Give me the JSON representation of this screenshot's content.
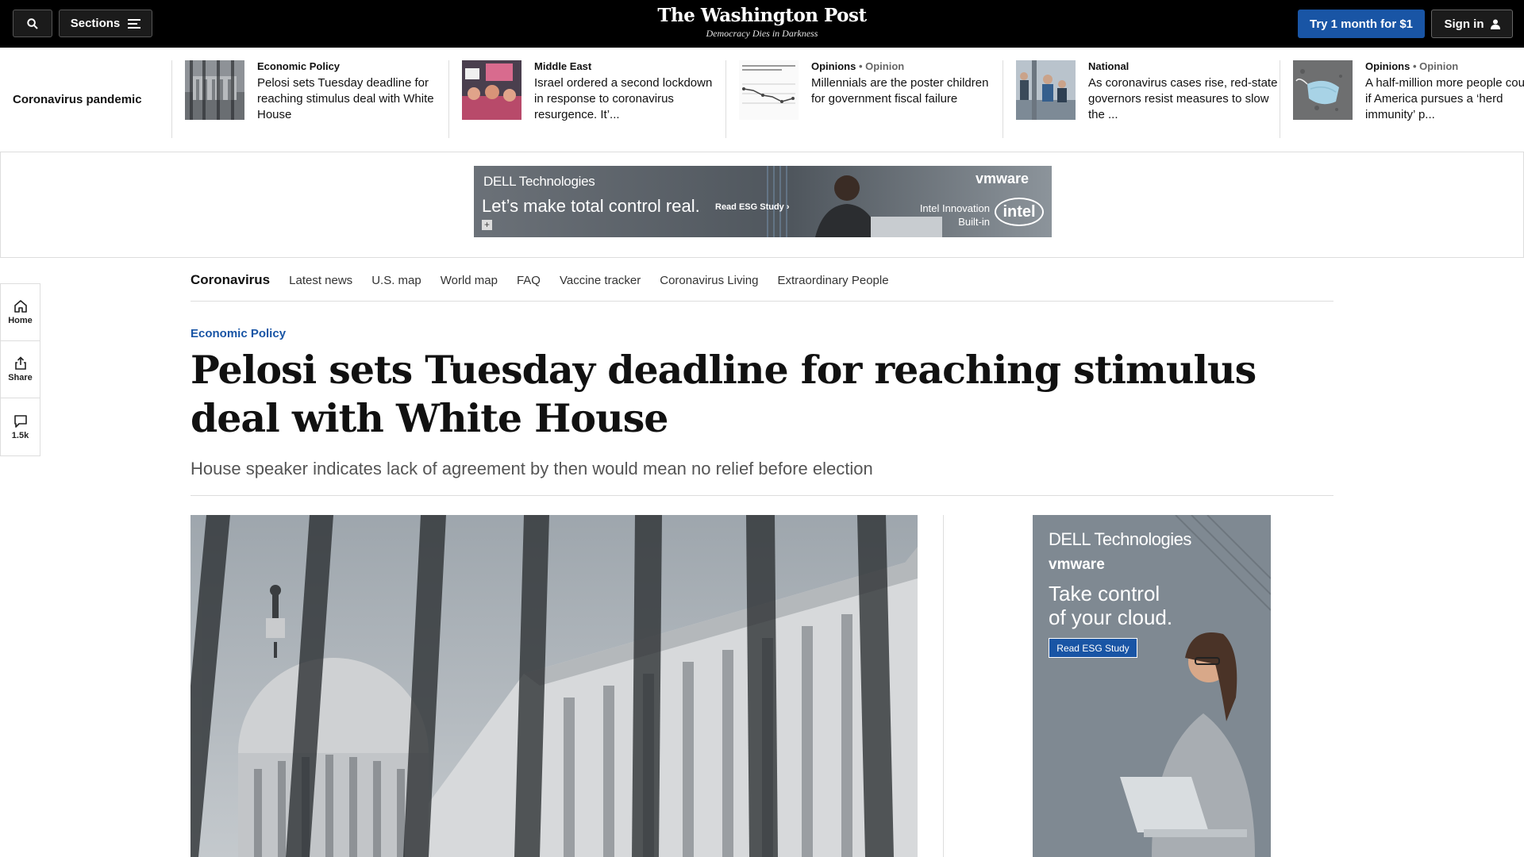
{
  "topbar": {
    "sections_label": "Sections",
    "logo_name": "The Washington Post",
    "logo_tagline": "Democracy Dies in Darkness",
    "try_label": "Try 1 month for $1",
    "signin_label": "Sign in",
    "bg_color": "#000000",
    "accent_color": "#1955a5"
  },
  "strip": {
    "label": "Coronavirus pandemic",
    "items": [
      {
        "kicker": "Economic Policy",
        "opinion": "",
        "headline": "Pelosi sets Tuesday deadline for reaching stimulus deal with White House",
        "thumb_icon": "capitol-building-photo"
      },
      {
        "kicker": "Middle East",
        "opinion": "",
        "headline": "Israel ordered a second lockdown in response to coronavirus resurgence. It’...",
        "thumb_icon": "protest-crowd-photo"
      },
      {
        "kicker": "Opinions",
        "opinion": "• Opinion",
        "headline": "Millennials are the poster children for government fiscal failure",
        "thumb_icon": "line-chart-thumbnail"
      },
      {
        "kicker": "National",
        "opinion": "",
        "headline": "As coronavirus cases rise, red-state governors resist measures to slow the ...",
        "thumb_icon": "people-seated-photo"
      },
      {
        "kicker": "Opinions",
        "opinion": "• Opinion",
        "headline": "A half-million more people could die if America pursues a ‘herd immunity’ p...",
        "thumb_icon": "face-mask-photo"
      }
    ]
  },
  "ad_banner": {
    "brand": "DELL Technologies",
    "line": "Let’s make total control real.",
    "cta": "Read ESG Study ›",
    "partner": "vmware",
    "intel_text": "Intel Innovation Built-in",
    "intel_logo": "intel"
  },
  "section_nav": {
    "title": "Coronavirus",
    "links": [
      "Latest news",
      "U.S. map",
      "World map",
      "FAQ",
      "Vaccine tracker",
      "Coronavirus Living",
      "Extraordinary People"
    ]
  },
  "rail": {
    "home": "Home",
    "share": "Share",
    "comments": "1.5k"
  },
  "article": {
    "kicker": "Economic Policy",
    "headline": "Pelosi sets Tuesday deadline for reaching stimulus deal with White House",
    "dek": "House speaker indicates lack of agreement by then would mean no relief before election",
    "image_icon": "us-capitol-photo"
  },
  "side_ad": {
    "brand": "DELL Technologies",
    "partner": "vmware",
    "headline": "Take control of your cloud.",
    "cta": "Read ESG Study",
    "image_icon": "woman-with-laptop-photo"
  }
}
